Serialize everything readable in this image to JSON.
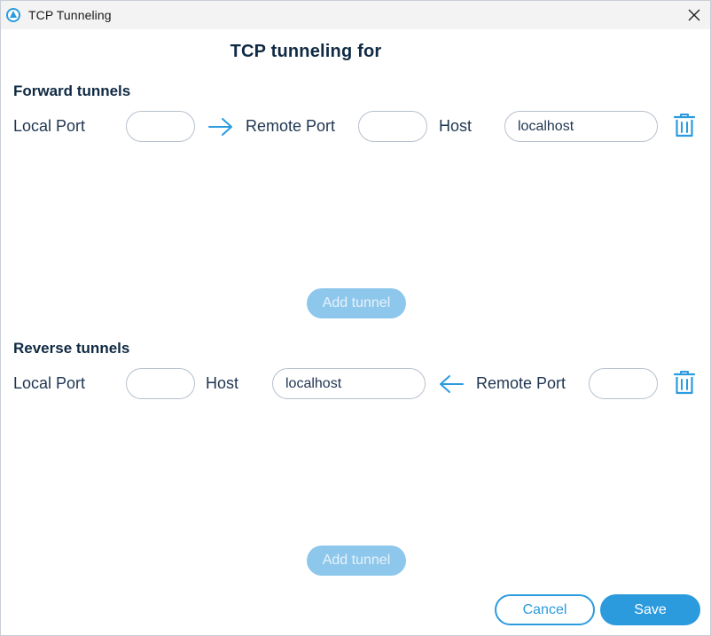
{
  "window": {
    "title": "TCP Tunneling",
    "app_icon": "app-logo-icon",
    "close_icon": "close-icon"
  },
  "heading": "TCP tunneling for",
  "forward": {
    "section_title": "Forward tunnels",
    "local_port_label": "Local Port",
    "local_port_value": "",
    "arrow_icon": "arrow-right-icon",
    "remote_port_label": "Remote Port",
    "remote_port_value": "",
    "host_label": "Host",
    "host_value": "localhost",
    "delete_icon": "trash-icon",
    "add_button_label": "Add tunnel"
  },
  "reverse": {
    "section_title": "Reverse tunnels",
    "local_port_label": "Local Port",
    "local_port_value": "",
    "host_label": "Host",
    "host_value": "localhost",
    "arrow_icon": "arrow-left-icon",
    "remote_port_label": "Remote Port",
    "remote_port_value": "",
    "delete_icon": "trash-icon",
    "add_button_label": "Add tunnel"
  },
  "footer": {
    "cancel_label": "Cancel",
    "save_label": "Save"
  },
  "colors": {
    "accent": "#2b9bde",
    "accent_disabled": "#8ec7ec",
    "heading_text": "#102a43",
    "titlebar_bg": "#f3f3f3"
  }
}
